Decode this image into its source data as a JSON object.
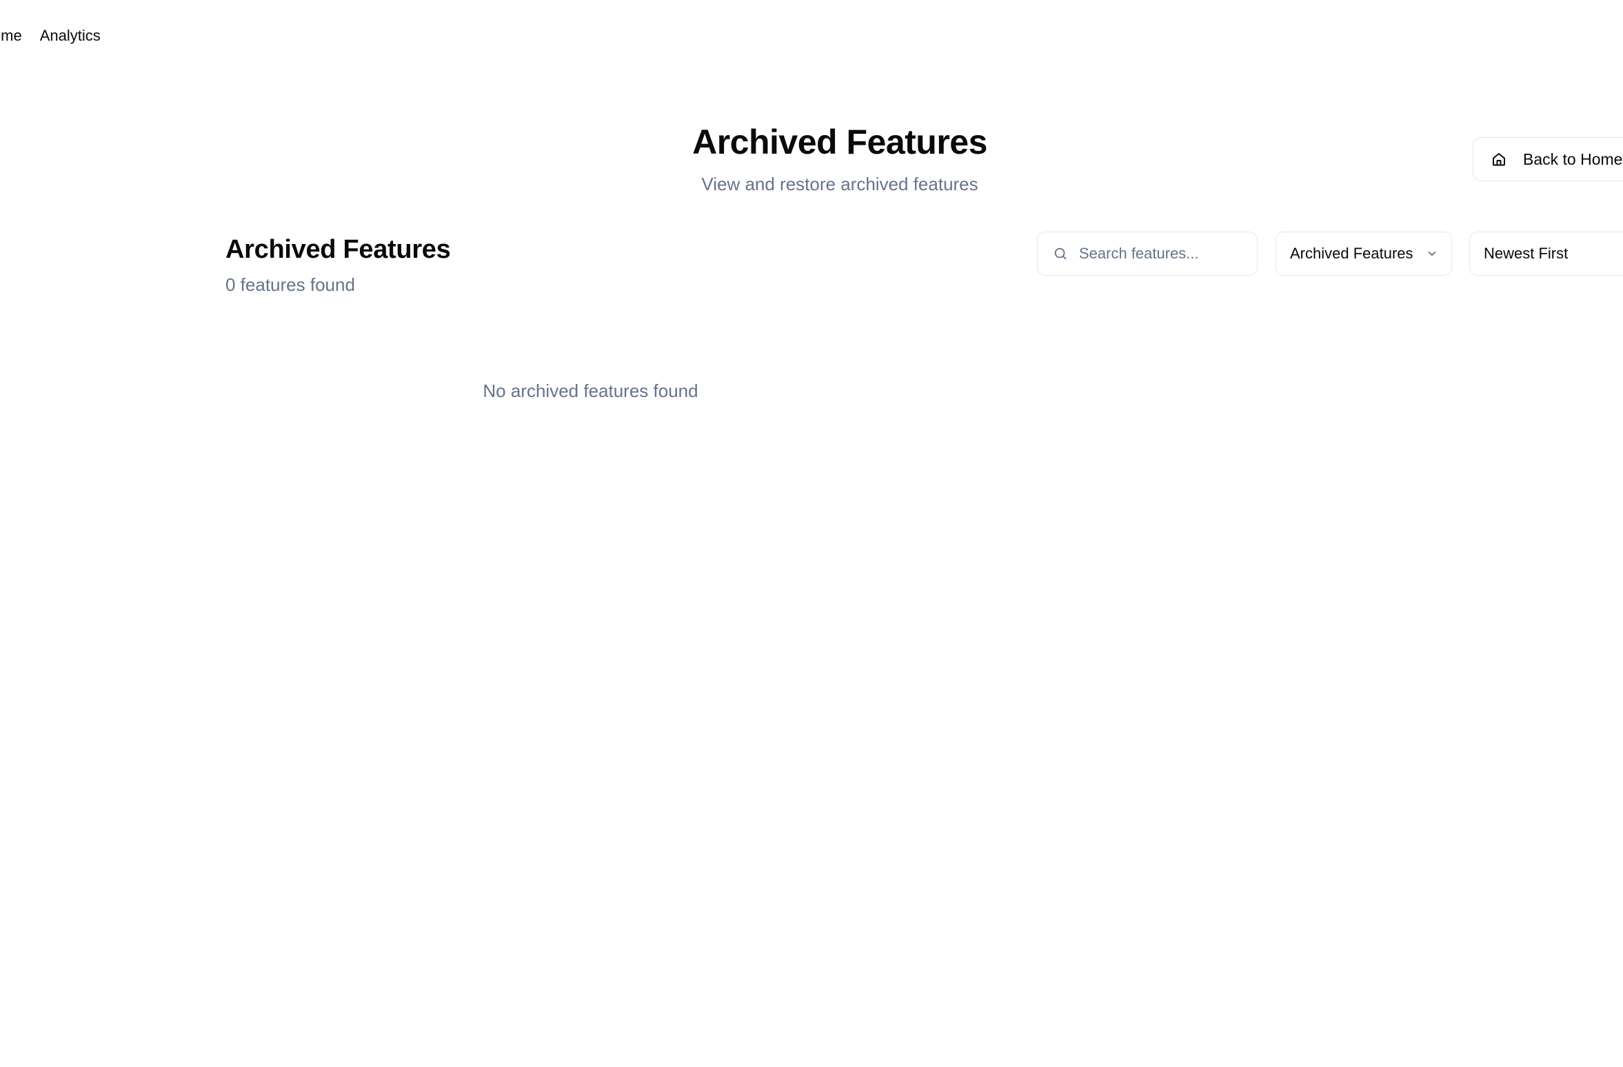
{
  "nav": {
    "items": [
      {
        "label": "Home"
      },
      {
        "label": "Analytics"
      }
    ]
  },
  "header": {
    "title": "Archived Features",
    "subtitle": "View and restore archived features",
    "back_label": "Back to Home",
    "back_icon": "home-icon"
  },
  "section": {
    "title": "Archived Features",
    "count": "0 features found"
  },
  "controls": {
    "search": {
      "placeholder": "Search features...",
      "value": "",
      "icon": "search-icon"
    },
    "filter": {
      "selected": "Archived Features",
      "icon": "chevron-down-icon"
    },
    "sort": {
      "selected": "Newest First",
      "icon": "chevron-down-icon"
    }
  },
  "empty_state": {
    "message": "No archived features found"
  },
  "colors": {
    "text": "#0a0a0a",
    "muted": "#64748b",
    "border": "#e5e7eb",
    "background": "#ffffff"
  }
}
